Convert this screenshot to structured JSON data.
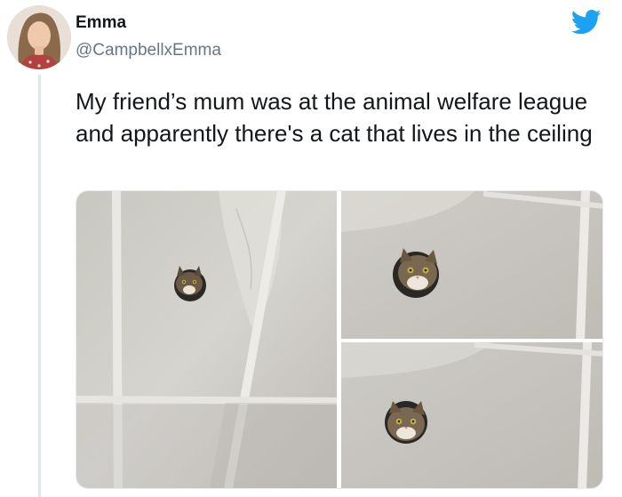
{
  "tweet": {
    "author": {
      "display_name": "Emma",
      "handle": "@CampbellxEmma"
    },
    "text": "My friend’s mum was at the animal welfare league and apparently there's a cat that lives in the ceiling",
    "media": [
      {
        "subject": "cat peeking through round hole in ceiling tile"
      },
      {
        "subject": "cat peeking through round hole in ceiling tile (close-up)"
      },
      {
        "subject": "cat peeking through round hole in ceiling tile (close-up)"
      }
    ]
  },
  "icons": {
    "platform": "twitter-bird-icon"
  },
  "colors": {
    "brand_blue": "#1da1f2",
    "handle_gray": "#657786",
    "text": "#14171a",
    "thread_line": "#e1e8ed"
  }
}
